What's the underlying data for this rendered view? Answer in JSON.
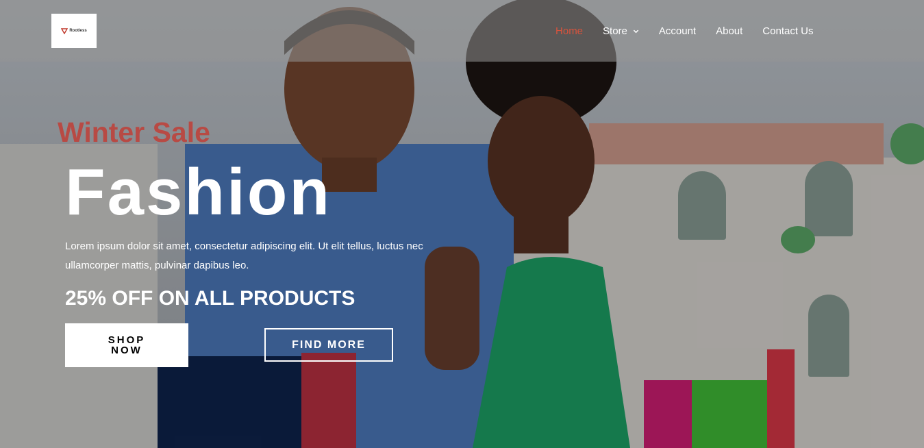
{
  "colors": {
    "accent": "#b84a44",
    "nav_active": "#d9533c",
    "text": "#ffffff"
  },
  "header": {
    "logo_text": "Rootless",
    "nav": [
      {
        "label": "Home",
        "active": true
      },
      {
        "label": "Store",
        "has_dropdown": true
      },
      {
        "label": "Account"
      },
      {
        "label": "About"
      },
      {
        "label": "Contact Us"
      }
    ]
  },
  "hero": {
    "kicker": "Winter Sale",
    "headline": "Fashion",
    "description": "Lorem ipsum dolor sit amet, consectetur adipiscing elit. Ut elit tellus, luctus nec ullamcorper mattis, pulvinar dapibus leo.",
    "promo": "25% OFF ON ALL PRODUCTS",
    "primary_button": "SHOP NOW",
    "secondary_button": "FIND MORE"
  },
  "icons": {
    "dropdown": "chevron-down-icon",
    "logo": "rootless-logo-mark"
  }
}
